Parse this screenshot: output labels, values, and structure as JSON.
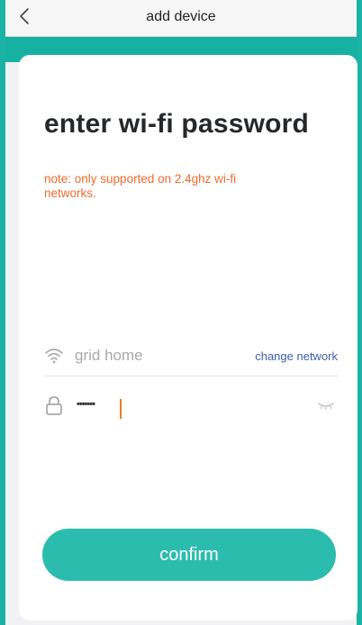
{
  "navbar": {
    "title": "add device",
    "back_icon": "chevron-left-icon"
  },
  "main": {
    "heading": "enter wi-fi password",
    "note": "note: only supported on 2.4ghz wi-fi networks.",
    "network": {
      "icon": "wifi-icon",
      "name": "grid home",
      "change_label": "change network"
    },
    "password": {
      "icon": "lock-icon",
      "value_masked": "•••••••",
      "toggle_icon": "eye-closed-icon"
    },
    "confirm_label": "confirm"
  },
  "colors": {
    "accent": "#2cbcae",
    "frame": "#1ab3a6",
    "note": "#f26a2b",
    "link": "#3b5fae",
    "caret": "#f07a1e"
  }
}
